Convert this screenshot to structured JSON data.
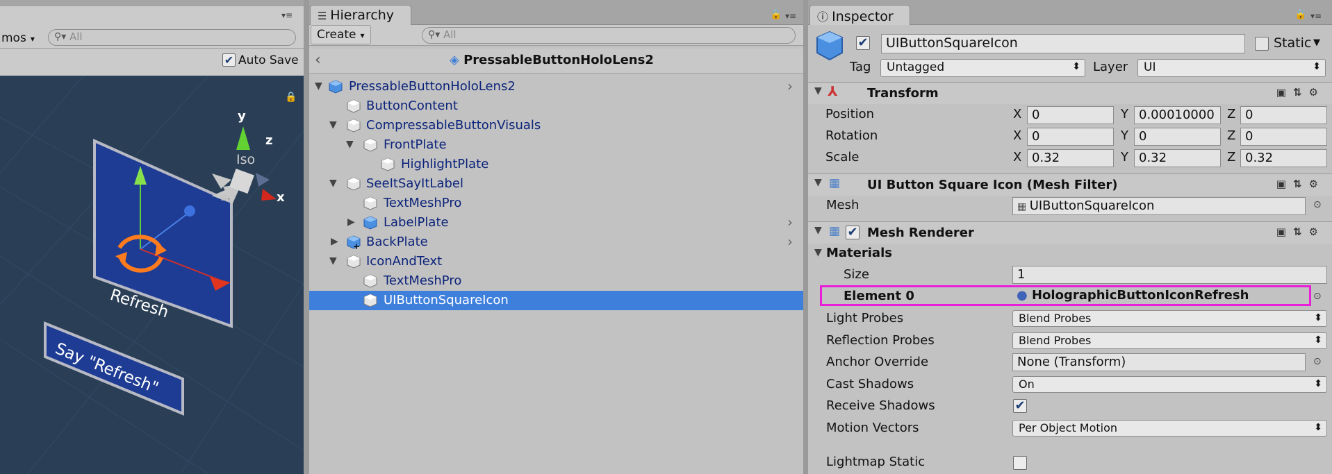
{
  "scene": {
    "gizmos_label": "mos",
    "search_placeholder": "All",
    "auto_save_label": "Auto Save",
    "auto_save_checked": true,
    "axis_y": "y",
    "axis_z": "z",
    "axis_x": "x",
    "iso_label": "Iso",
    "button_label": "Refresh",
    "say_label": "Say \"Refresh\""
  },
  "hierarchy": {
    "tab_label": "Hierarchy",
    "create_label": "Create",
    "search_placeholder": "All",
    "prefab_title": "PressableButtonHoloLens2",
    "items": [
      {
        "label": "PressableButtonHoloLens2"
      },
      {
        "label": "ButtonContent"
      },
      {
        "label": "CompressableButtonVisuals"
      },
      {
        "label": "FrontPlate"
      },
      {
        "label": "HighlightPlate"
      },
      {
        "label": "SeeItSayItLabel"
      },
      {
        "label": "TextMeshPro"
      },
      {
        "label": "LabelPlate"
      },
      {
        "label": "BackPlate"
      },
      {
        "label": "IconAndText"
      },
      {
        "label": "TextMeshPro"
      },
      {
        "label": "UIButtonSquareIcon"
      }
    ]
  },
  "inspector": {
    "tab_label": "Inspector",
    "object_name": "UIButtonSquareIcon",
    "active_checked": true,
    "static_label": "Static",
    "tag_label": "Tag",
    "tag_value": "Untagged",
    "layer_label": "Layer",
    "layer_value": "UI",
    "transform": {
      "title": "Transform",
      "position_label": "Position",
      "rotation_label": "Rotation",
      "scale_label": "Scale",
      "x": "X",
      "y": "Y",
      "z": "Z",
      "position": [
        "0",
        "0.00010000",
        "0"
      ],
      "rotation": [
        "0",
        "0",
        "0"
      ],
      "scale": [
        "0.32",
        "0.32",
        "0.32"
      ]
    },
    "mesh_filter": {
      "title": "UI Button Square Icon (Mesh Filter)",
      "mesh_label": "Mesh",
      "mesh_value": "UIButtonSquareIcon"
    },
    "mesh_renderer": {
      "title": "Mesh Renderer",
      "enabled": true,
      "materials_label": "Materials",
      "size_label": "Size",
      "size_value": "1",
      "element0_label": "Element 0",
      "element0_value": "HolographicButtonIconRefresh",
      "light_probes_label": "Light Probes",
      "light_probes_value": "Blend Probes",
      "reflection_probes_label": "Reflection Probes",
      "reflection_probes_value": "Blend Probes",
      "anchor_override_label": "Anchor Override",
      "anchor_override_value": "None (Transform)",
      "cast_shadows_label": "Cast Shadows",
      "cast_shadows_value": "On",
      "receive_shadows_label": "Receive Shadows",
      "receive_shadows_checked": true,
      "motion_vectors_label": "Motion Vectors",
      "motion_vectors_value": "Per Object Motion",
      "lightmap_static_label": "Lightmap Static",
      "lightmap_static_checked": false
    }
  },
  "colors": {
    "selection": "#3e7fdc",
    "highlight_border": "#e81ed8",
    "scene_bg": "#2a3f56"
  }
}
